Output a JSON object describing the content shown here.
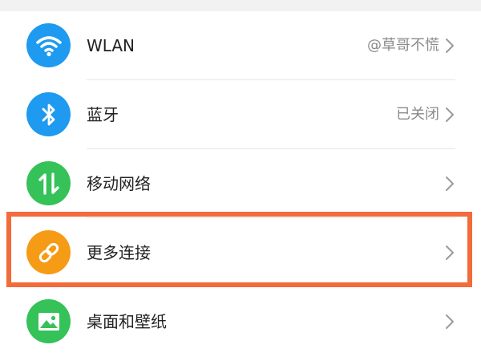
{
  "colors": {
    "wlan": "#1e9af0",
    "bluetooth": "#1e9af0",
    "mobile": "#34c259",
    "more": "#f59b16",
    "wallpaper": "#34c259",
    "highlight": "#f26b3a"
  },
  "settings": {
    "items": [
      {
        "label": "WLAN",
        "value": "@草哥不慌",
        "icon": "wifi-icon"
      },
      {
        "label": "蓝牙",
        "value": "已关闭",
        "icon": "bluetooth-icon"
      },
      {
        "label": "移动网络",
        "value": "",
        "icon": "mobile-data-icon"
      },
      {
        "label": "更多连接",
        "value": "",
        "icon": "link-icon"
      },
      {
        "label": "桌面和壁纸",
        "value": "",
        "icon": "image-icon"
      }
    ]
  }
}
